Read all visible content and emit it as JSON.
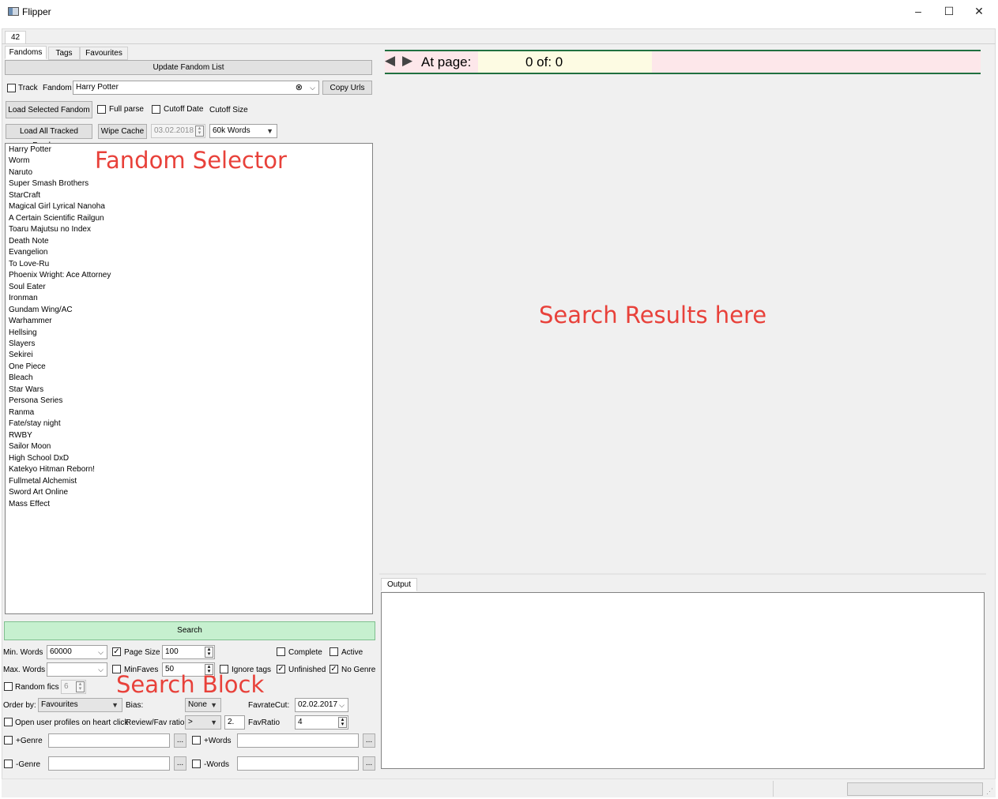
{
  "window": {
    "title": "Flipper",
    "minimize_icon": "–",
    "maximize_icon": "☐",
    "close_icon": "✕"
  },
  "top_tab": "42",
  "left_tabs": [
    "Fandoms",
    "Tags",
    "Favourites"
  ],
  "fandom_panel": {
    "update_button": "Update Fandom List",
    "track_label": "Track",
    "fandom_label": "Fandom",
    "fandom_value": "Harry Potter",
    "copy_urls_button": "Copy Urls",
    "load_selected_button": "Load Selected Fandom",
    "full_parse_label": "Full parse",
    "cutoff_date_label": "Cutoff Date",
    "cutoff_size_label": "Cutoff Size",
    "load_all_button": "Load All Tracked Fandoms",
    "wipe_cache_button": "Wipe Cache",
    "cutoff_date_value": "03.02.2018",
    "cutoff_size_value": "60k Words"
  },
  "fandoms": [
    "Harry Potter",
    "Worm",
    "Naruto",
    "Super Smash Brothers",
    "StarCraft",
    "Magical Girl Lyrical Nanoha",
    "A Certain Scientific Railgun",
    "Toaru Majutsu no Index",
    "Death Note",
    "Evangelion",
    "To Love-Ru",
    "Phoenix Wright: Ace Attorney",
    "Soul Eater",
    "Ironman",
    "Gundam Wing/AC",
    "Warhammer",
    "Hellsing",
    "Slayers",
    "Sekirei",
    "One Piece",
    "Bleach",
    "Star Wars",
    "Persona Series",
    "Ranma",
    "Fate/stay night",
    "RWBY",
    "Sailor Moon",
    "High School DxD",
    "Katekyo Hitman Reborn!",
    "Fullmetal Alchemist",
    "Sword Art Online",
    "Mass Effect"
  ],
  "annotations": {
    "fandom_selector": "Fandom Selector",
    "search_results": "Search Results here",
    "search_block": "Search Block"
  },
  "search": {
    "search_button": "Search",
    "min_words_label": "Min. Words",
    "min_words_value": "60000",
    "page_size_label": "Page Size",
    "page_size_value": "100",
    "complete_label": "Complete",
    "active_label": "Active",
    "max_words_label": "Max. Words",
    "max_words_value": "",
    "min_faves_label": "MinFaves",
    "min_faves_value": "50",
    "ignore_tags_label": "Ignore tags",
    "unfinished_label": "Unfinished",
    "no_genre_label": "No Genre",
    "random_fics_label": "Random fics",
    "random_fics_value": "6",
    "order_by_label": "Order by:",
    "order_by_value": "Favourites",
    "bias_label": "Bias:",
    "bias_value": "None",
    "favrate_cut_label": "FavrateCut:",
    "favrate_cut_value": "02.02.2017",
    "open_profiles_label": "Open user profiles on heart click",
    "review_fav_label": "Review/Fav ratio",
    "review_fav_op": ">",
    "review_fav_value": "2.",
    "fav_ratio_label": "FavRatio",
    "fav_ratio_value": "4",
    "plus_genre_label": "+Genre",
    "plus_words_label": "+Words",
    "minus_genre_label": "-Genre",
    "minus_words_label": "-Words",
    "ellipsis": "..."
  },
  "pager": {
    "at_page_label": "At page:",
    "page_value": "0 of: 0"
  },
  "output_tab": "Output",
  "colors": {
    "search_button": "#c6f0cf",
    "pager_bg": "#fde7ea",
    "pager_border": "#207040",
    "annotation_red": "#e8413a"
  }
}
